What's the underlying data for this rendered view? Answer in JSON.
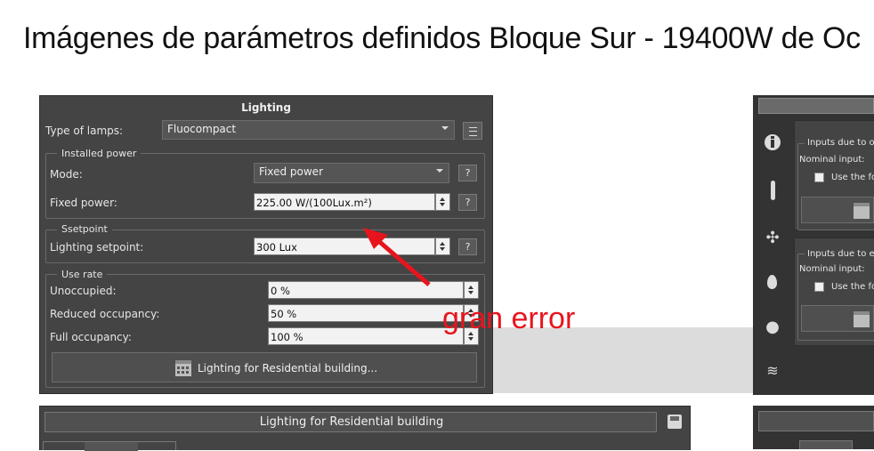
{
  "slide": {
    "title": "Imágenes de parámetros definidos Bloque Sur -  19400W de Oc"
  },
  "lighting_panel": {
    "title": "Lighting",
    "type_of_lamps": {
      "label": "Type of lamps:",
      "value": "Fluocompact"
    },
    "installed_power": {
      "legend": "Installed power",
      "mode": {
        "label": "Mode:",
        "value": "Fixed power",
        "help": "?"
      },
      "fixed_power": {
        "label": "Fixed power:",
        "value": "225.00 W/(100Lux.m²)",
        "help": "?"
      }
    },
    "setpoint": {
      "legend": "Ssetpoint",
      "lighting_setpoint": {
        "label": "Lighting setpoint:",
        "value": "300 Lux",
        "help": "?"
      }
    },
    "use_rate": {
      "legend": "Use rate",
      "unoccupied": {
        "label": "Unoccupied:",
        "value": "0 %"
      },
      "reduced": {
        "label": "Reduced occupancy:",
        "value": "50 %"
      },
      "full": {
        "label": "Full occupancy:",
        "value": "100 %"
      }
    },
    "schedule_button": "Lighting for Residential building..."
  },
  "annotation": {
    "text": "gran error",
    "color": "#e8141d"
  },
  "bottom_panel": {
    "title": "Lighting for Residential building"
  },
  "right_panel": {
    "group1": {
      "legend": "Inputs due to o",
      "nominal": "Nominal input:",
      "checkbox": "Use the fo"
    },
    "group2": {
      "legend": "Inputs due to e",
      "nominal": "Nominal input:",
      "checkbox": "Use the fo"
    },
    "icons": [
      "info-icon",
      "thermometer-icon",
      "fan-icon",
      "drop-icon",
      "lightbulb-icon",
      "heat-icon"
    ]
  },
  "colors": {
    "panel_bg": "#444444",
    "input_bg": "#f2f2f2",
    "annotation": "#e8141d"
  }
}
